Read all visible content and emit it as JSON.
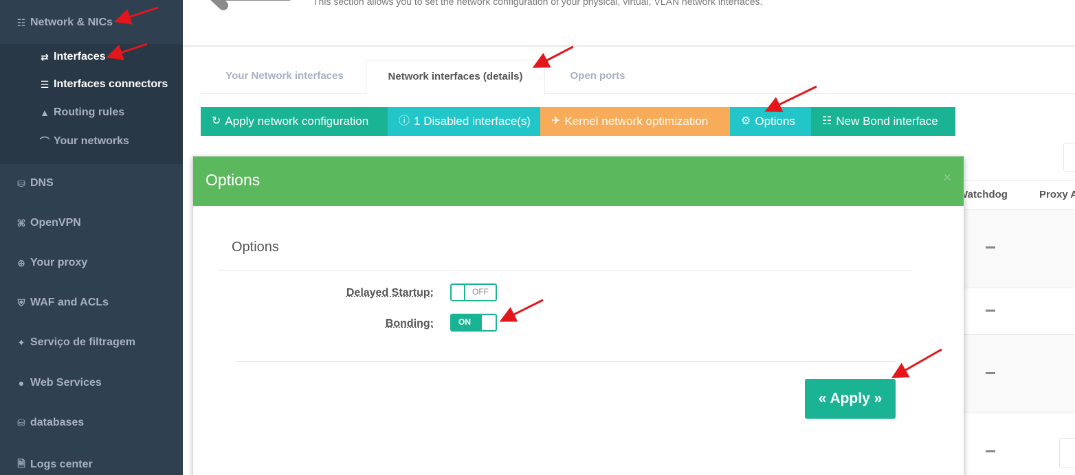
{
  "sidebar": {
    "section": {
      "label": "Network & NICs",
      "icon": "sitemap-icon"
    },
    "subitems": [
      {
        "label": "Interfaces",
        "icon": "exchange-icon",
        "active": true
      },
      {
        "label": "Interfaces connectors",
        "icon": "router-icon"
      },
      {
        "label": "Routing rules",
        "icon": "road-icon"
      },
      {
        "label": "Your networks",
        "icon": "wifi-icon"
      }
    ],
    "items": [
      {
        "label": "DNS",
        "icon": "database-icon"
      },
      {
        "label": "OpenVPN",
        "icon": "compress-icon"
      },
      {
        "label": "Your proxy",
        "icon": "globe-icon"
      },
      {
        "label": "WAF and ACLs",
        "icon": "shield-icon"
      },
      {
        "label": "Serviço de filtragem",
        "icon": "badge-shield-icon"
      },
      {
        "label": "Web Services",
        "icon": "globe-filled-icon"
      },
      {
        "label": "databases",
        "icon": "database-icon"
      },
      {
        "label": "Logs center",
        "icon": "file-icon"
      }
    ]
  },
  "header": {
    "description": "This section allows you to set the network configuration of your physical, virtual, VLAN network interfaces."
  },
  "tabs": [
    {
      "label": "Your Network interfaces"
    },
    {
      "label": "Network interfaces (details)",
      "active": true
    },
    {
      "label": "Open ports"
    }
  ],
  "toolbar": {
    "apply_config": "Apply network configuration",
    "disabled_ifaces": "1 Disabled interface(s)",
    "kernel_opt": "Kernel network optimization",
    "options": "Options",
    "new_bond": "New Bond interface"
  },
  "table": {
    "headers": [
      "Watchdog",
      "Proxy A"
    ],
    "rows": [
      "—",
      "—",
      "—",
      "—"
    ]
  },
  "modal": {
    "title": "Options",
    "close": "×",
    "legend": "Options",
    "fields": [
      {
        "label": "Delayed Startup:",
        "state": "OFF"
      },
      {
        "label": "Bonding:",
        "state": "ON"
      }
    ],
    "apply_label": "« Apply »"
  },
  "colors": {
    "sidebar_bg": "#2f4050",
    "teal": "#1ab394",
    "cyan": "#23c6c8",
    "orange": "#f8ac59",
    "modal_header": "#5cb85c",
    "annotation_arrow": "#e3161b"
  }
}
